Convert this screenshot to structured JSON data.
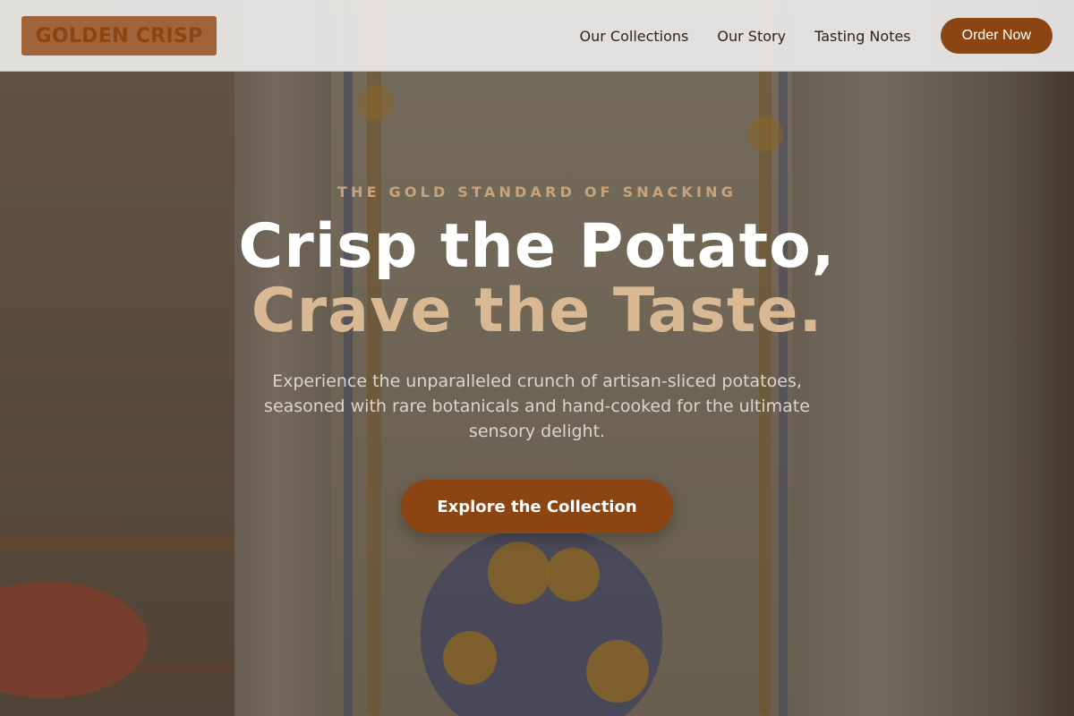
{
  "brand": {
    "logo_text": "GOLDEN CRISP",
    "logo_bg": "#a0633a",
    "accent": "#8b4513"
  },
  "nav": {
    "links": [
      "Our Collections",
      "Our Story",
      "Tasting Notes"
    ],
    "order_label": "Order Now"
  },
  "hero": {
    "eyebrow": "THE GOLD STANDARD OF SNACKING",
    "headline_line1": "Crisp the Potato,",
    "headline_line2": "Crave the Taste.",
    "subtext": "Experience the unparalleled crunch of artisan-sliced potatoes, seasoned with rare botanicals and hand-cooked for the ultimate sensory delight.",
    "cta_label": "Explore the Collection",
    "headline_accent_color": "#d8b994",
    "eyebrow_color": "#c8a37c"
  }
}
